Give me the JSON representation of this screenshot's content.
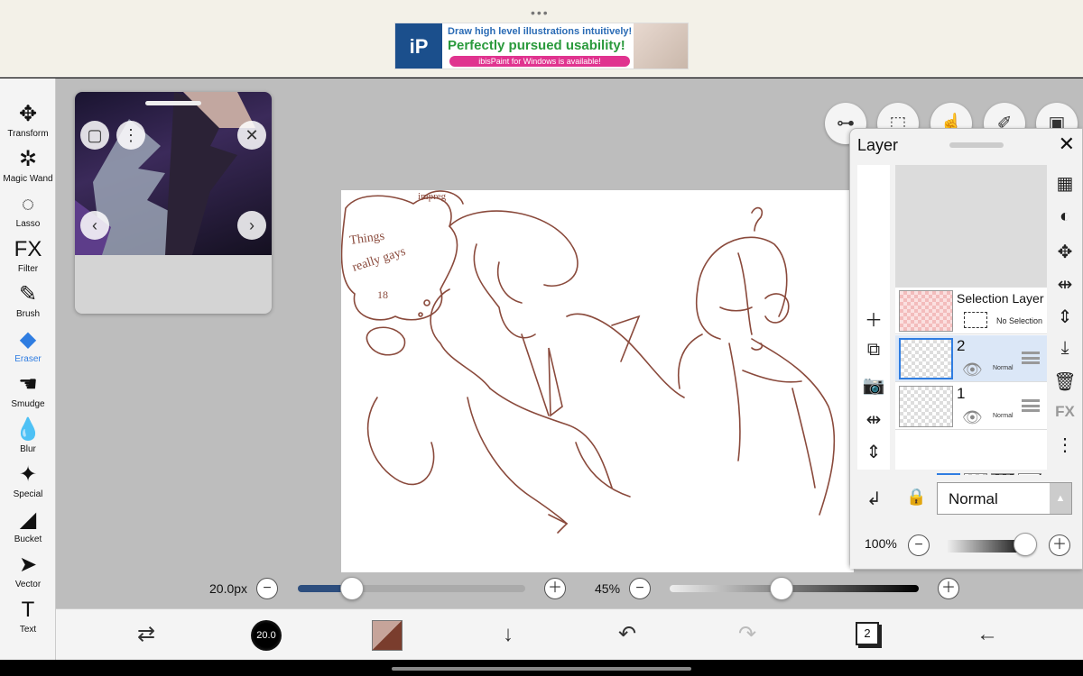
{
  "app": {
    "ad": {
      "logo": "iP",
      "line1": "Draw high level illustrations intuitively!",
      "line2": "Perfectly pursued usability!",
      "line3": "ibisPaint for Windows is available!"
    }
  },
  "tools": [
    {
      "name": "transform",
      "label": "Transform",
      "icon": "✥"
    },
    {
      "name": "magic-wand",
      "label": "Magic Wand",
      "icon": "✲"
    },
    {
      "name": "lasso",
      "label": "Lasso",
      "icon": "◌"
    },
    {
      "name": "filter",
      "label": "Filter",
      "icon": "FX"
    },
    {
      "name": "brush",
      "label": "Brush",
      "icon": "✎"
    },
    {
      "name": "eraser",
      "label": "Eraser",
      "icon": "◆"
    },
    {
      "name": "smudge",
      "label": "Smudge",
      "icon": "☚"
    },
    {
      "name": "blur",
      "label": "Blur",
      "icon": "💧"
    },
    {
      "name": "special",
      "label": "Special",
      "icon": "✦"
    },
    {
      "name": "bucket",
      "label": "Bucket",
      "icon": "◢"
    },
    {
      "name": "vector",
      "label": "Vector",
      "icon": "➤"
    },
    {
      "name": "text",
      "label": "Text",
      "icon": "T"
    }
  ],
  "active_tool": "Eraser",
  "layer_panel": {
    "title": "Layer",
    "selection_layer": {
      "name": "Selection Layer",
      "status": "No Selection"
    },
    "layers": [
      {
        "number": "2",
        "blend": "Normal",
        "selected": true
      },
      {
        "number": "1",
        "blend": "Normal",
        "selected": false
      }
    ],
    "blend_mode": "Normal",
    "opacity": "100%",
    "opacity_value": 100
  },
  "sliders": {
    "brush_size": "20.0px",
    "brush_size_fraction": 0.24,
    "brush_opacity": "45%",
    "brush_opacity_fraction": 0.45
  },
  "bottom": {
    "brush_preview": "20.0",
    "layer_count": "2"
  },
  "colors": {
    "accent": "#2f7de1",
    "line_art": "#8a4a3c",
    "secondary_color": "#7a3d2d"
  }
}
